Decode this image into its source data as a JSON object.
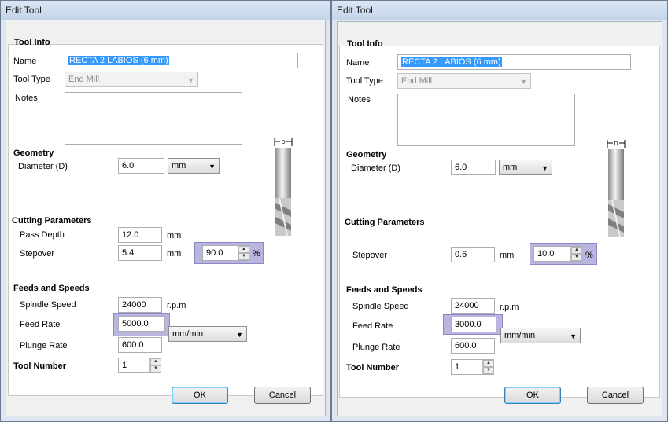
{
  "dialogs": [
    {
      "title": "Edit Tool",
      "tool_info": {
        "header": "Tool Info",
        "name_label": "Name",
        "name_value": "RECTA 2 LABIOS (6 mm)",
        "tool_type_label": "Tool Type",
        "tool_type_value": "End Mill",
        "notes_label": "Notes"
      },
      "geometry": {
        "header": "Geometry",
        "diameter_label": "Diameter (D)",
        "diameter_value": "6.0",
        "units_value": "mm"
      },
      "diagram": {
        "dimension_label": "D"
      },
      "cutting": {
        "header": "Cutting Parameters",
        "pass_depth_label": "Pass Depth",
        "pass_depth_value": "12.0",
        "pass_depth_unit": "mm",
        "stepover_label": "Stepover",
        "stepover_value": "5.4",
        "stepover_unit": "mm",
        "stepover_percent_value": "90.0",
        "percent_sign": "%"
      },
      "feeds": {
        "header": "Feeds and Speeds",
        "spindle_label": "Spindle Speed",
        "spindle_value": "24000",
        "spindle_unit": "r.p.m",
        "feed_label": "Feed Rate",
        "feed_value": "5000.0",
        "rate_units_value": "mm/min",
        "plunge_label": "Plunge Rate",
        "plunge_value": "600.0"
      },
      "tool_number": {
        "label": "Tool Number",
        "value": "1"
      },
      "buttons": {
        "ok": "OK",
        "cancel": "Cancel"
      }
    },
    {
      "title": "Edit Tool",
      "tool_info": {
        "header": "Tool Info",
        "name_label": "Name",
        "name_value": "RECTA 2 LABIOS (6 mm)",
        "tool_type_label": "Tool Type",
        "tool_type_value": "End Mill",
        "notes_label": "Notes"
      },
      "geometry": {
        "header": "Geometry",
        "diameter_label": "Diameter (D)",
        "diameter_value": "6.0",
        "units_value": "mm"
      },
      "diagram": {
        "dimension_label": "D"
      },
      "cutting": {
        "header": "Cutting Parameters",
        "stepover_label": "Stepover",
        "stepover_value": "0.6",
        "stepover_unit": "mm",
        "stepover_percent_value": "10.0",
        "percent_sign": "%"
      },
      "feeds": {
        "header": "Feeds and Speeds",
        "spindle_label": "Spindle Speed",
        "spindle_value": "24000",
        "spindle_unit": "r.p.m",
        "feed_label": "Feed Rate",
        "feed_value": "3000.0",
        "rate_units_value": "mm/min",
        "plunge_label": "Plunge Rate",
        "plunge_value": "600.0"
      },
      "tool_number": {
        "label": "Tool Number",
        "value": "1"
      },
      "buttons": {
        "ok": "OK",
        "cancel": "Cancel"
      }
    }
  ],
  "colors": {
    "highlight": "#b8b5de",
    "selection": "#3399ff",
    "default_button_border": "#3c7fb1"
  }
}
